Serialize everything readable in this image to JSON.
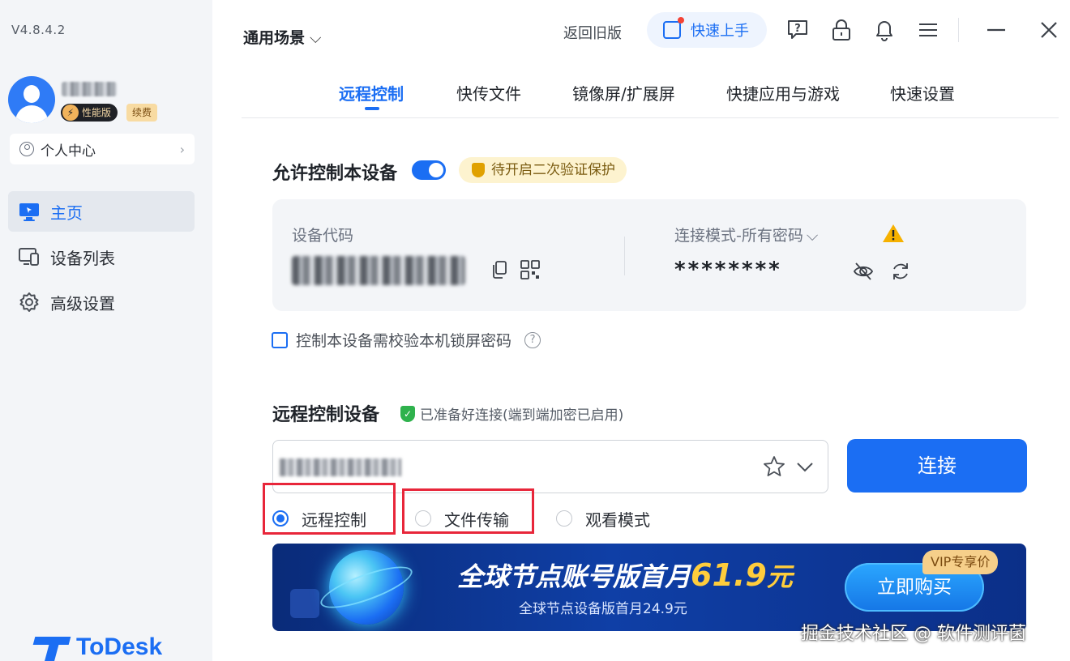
{
  "app": {
    "version": "V4.8.4.2",
    "brand": "ToDesk",
    "accent_color": "#1b6ef3"
  },
  "sidebar": {
    "user": {
      "edition_badge": "性能版",
      "renew_badge": "续费"
    },
    "personal_center": "个人中心",
    "items": [
      {
        "label": "主页",
        "icon": "monitor-icon",
        "active": true
      },
      {
        "label": "设备列表",
        "icon": "devices-icon",
        "active": false
      },
      {
        "label": "高级设置",
        "icon": "gear-icon",
        "active": false
      }
    ]
  },
  "header": {
    "scene": "通用场景",
    "old_version": "返回旧版",
    "quick_start": "快速上手",
    "icons": [
      "help-icon",
      "lock-icon",
      "bell-icon",
      "menu-icon",
      "minimize-icon",
      "close-icon"
    ]
  },
  "tabs": [
    {
      "label": "远程控制",
      "active": true
    },
    {
      "label": "快传文件",
      "active": false
    },
    {
      "label": "镜像屏/扩展屏",
      "active": false
    },
    {
      "label": "快捷应用与游戏",
      "active": false
    },
    {
      "label": "快速设置",
      "active": false
    }
  ],
  "allow_control": {
    "title": "允许控制本设备",
    "enabled": true,
    "warning": "待开启二次验证保护",
    "device_code_label": "设备代码",
    "connection_mode": "连接模式-所有密码",
    "password": "********",
    "lock_screen_check": "控制本设备需校验本机锁屏密码",
    "lock_screen_checked": false
  },
  "remote_control": {
    "title": "远程控制设备",
    "status": "已准备好连接(端到端加密已启用)",
    "connect_label": "连接",
    "modes": [
      {
        "label": "远程控制",
        "selected": true
      },
      {
        "label": "文件传输",
        "selected": false
      },
      {
        "label": "观看模式",
        "selected": false
      }
    ]
  },
  "banner": {
    "headline": "全球节点账号版首月",
    "price": "61.9",
    "unit": "元",
    "subline": "全球节点设备版首月24.9元",
    "vip_tag": "VIP专享价",
    "buy_label": "立即购买"
  },
  "watermark": "掘金技术社区 @ 软件测评菌"
}
